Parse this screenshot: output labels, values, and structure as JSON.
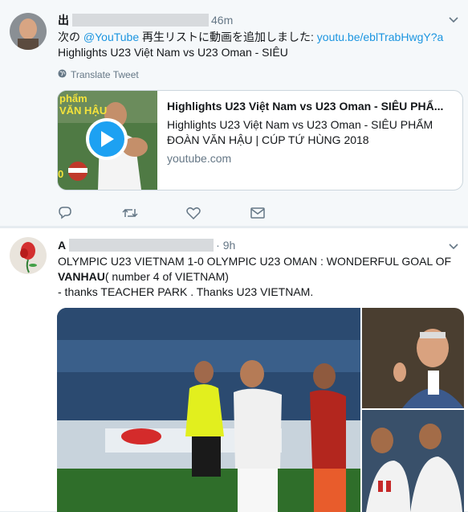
{
  "tweets": [
    {
      "name": "出",
      "time": "46m",
      "text_prefix": "次の ",
      "mention": "@YouTube",
      "text_middle": " 再生リストに動画を追加しました: ",
      "link": "youtu.be/eblTrabHwgY?a",
      "text_line2": "Highlights U23 Việt Nam vs U23 Oman - SIÊU",
      "translate_label": "Translate Tweet",
      "card": {
        "title": "Highlights U23 Việt Nam vs U23 Oman - SIÊU PHẨ...",
        "description": "Highlights U23 Việt Nam vs U23 Oman - SIÊU PHẨM ĐOÀN VĂN HẬU | CÚP TỨ HÙNG 2018",
        "domain": "youtube.com",
        "thumb_text_1": "phẩm",
        "thumb_text_2": "VĂN HẬU",
        "thumb_text_3": "0"
      }
    },
    {
      "name": "A",
      "time": "9h",
      "line1": "OLYMPIC U23 VIETNAM 1-0 OLYMPIC U23 OMAN : WONDERFUL GOAL OF",
      "line2_bold": "VANHAU",
      "line2_rest": "( number 4 of VIETNAM)",
      "line3": "- thanks TEACHER PARK . Thanks U23 VIETNAM."
    }
  ],
  "icons": {
    "reply": "reply-icon",
    "retweet": "retweet-icon",
    "like": "heart-icon",
    "dm": "envelope-icon",
    "caret": "chevron-down-icon",
    "globe": "globe-icon",
    "play": "play-icon"
  },
  "colors": {
    "link": "#1b95e0",
    "muted": "#657786",
    "youtube_play": "#1da1f2"
  }
}
